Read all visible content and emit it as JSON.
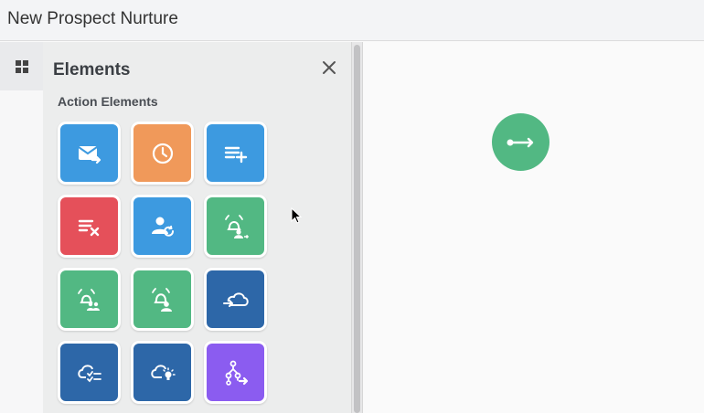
{
  "header": {
    "title": "New Prospect Nurture"
  },
  "rail": {
    "elements_icon": "grid-icon"
  },
  "panel": {
    "title": "Elements",
    "close_icon": "close-icon",
    "section_title": "Action Elements",
    "tiles": [
      {
        "name": "send-email",
        "icon": "email-send-icon",
        "color": "#3d9ae0"
      },
      {
        "name": "wait",
        "icon": "clock-icon",
        "color": "#f0995a"
      },
      {
        "name": "add-to-list",
        "icon": "list-add-icon",
        "color": "#3d9ae0"
      },
      {
        "name": "remove-from-list",
        "icon": "list-remove-icon",
        "color": "#e5505a"
      },
      {
        "name": "update-contact",
        "icon": "user-refresh-icon",
        "color": "#3d9ae0"
      },
      {
        "name": "notify-user",
        "icon": "bell-user-arrow-icon",
        "color": "#52b883"
      },
      {
        "name": "notify-team",
        "icon": "bell-group-icon",
        "color": "#52b883"
      },
      {
        "name": "notify-owner",
        "icon": "bell-user-icon",
        "color": "#52b883"
      },
      {
        "name": "cloud-sync",
        "icon": "cloud-arrow-icon",
        "color": "#2d67a8"
      },
      {
        "name": "cloud-task",
        "icon": "cloud-checklist-icon",
        "color": "#2d67a8"
      },
      {
        "name": "cloud-idea",
        "icon": "cloud-bulb-icon",
        "color": "#2d67a8"
      },
      {
        "name": "branch-split",
        "icon": "branch-arrow-icon",
        "color": "#8b5cf0"
      }
    ]
  },
  "canvas": {
    "start_node_icon": "start-arrow-icon",
    "start_node_color": "#52b883"
  }
}
